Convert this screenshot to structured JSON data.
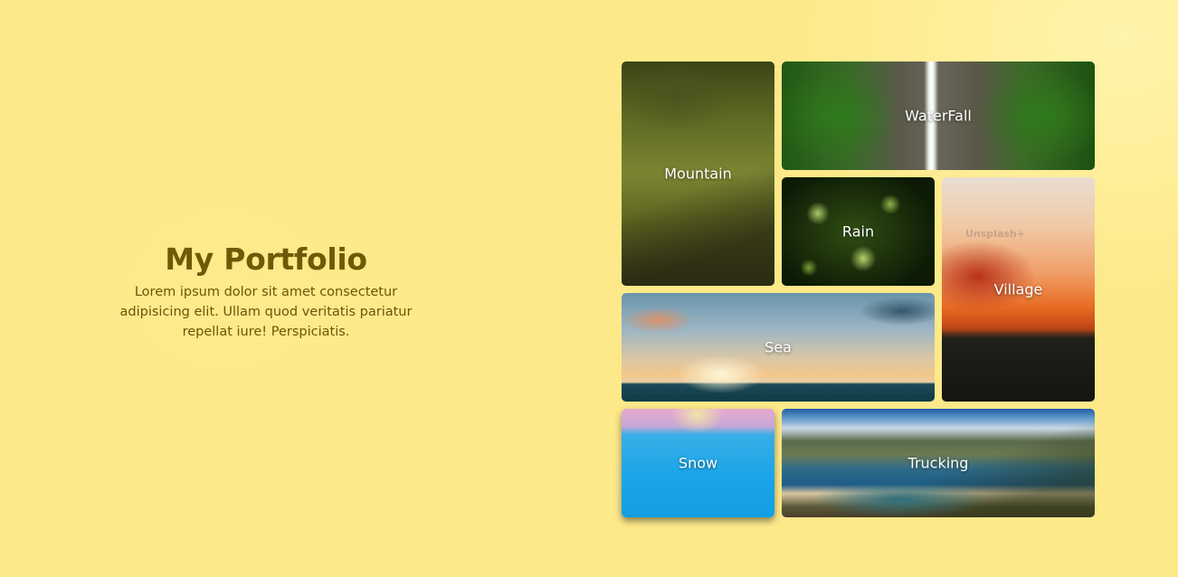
{
  "intro": {
    "title": "My Portfolio",
    "description": "Lorem ipsum dolor sit amet consectetur adipisicing elit. Ullam quod veritatis pariatur repellat iure! Perspiciatis."
  },
  "gallery": {
    "items": [
      {
        "label": "Mountain"
      },
      {
        "label": "WaterFall"
      },
      {
        "label": "Rain"
      },
      {
        "label": "Village"
      },
      {
        "label": "Sea"
      },
      {
        "label": "Snow"
      },
      {
        "label": "Trucking"
      }
    ],
    "watermark": "Unsplash+"
  },
  "colors": {
    "background": "#fde98a",
    "title": "#6e5a06",
    "text": "#6a5606",
    "label": "#ffffff"
  }
}
